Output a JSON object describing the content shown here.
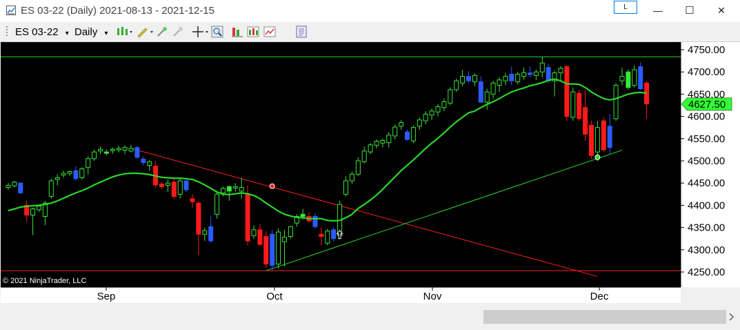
{
  "window": {
    "title": "ES 03-22 (Daily)  2021-08-13 - 2021-12-15",
    "link_button_label": "L",
    "minimize_glyph": "—",
    "maximize_glyph": "☐",
    "close_glyph": "✕"
  },
  "toolbar": {
    "instrument_label": "ES 03-22",
    "interval_label": "Daily",
    "dropdown_glyph": "▾",
    "icons": [
      "bar-style-icon",
      "drawing-tool-icon",
      "pencil-icon",
      "snap-icon",
      "crosshair-icon",
      "zoom-icon",
      "strategy-icon",
      "indicators-icon",
      "chart-properties-icon",
      "data-box-icon"
    ]
  },
  "colors": {
    "background": "#000000",
    "up_candle": "#39e639",
    "down_candle": "#ff1a1a",
    "blue_candle": "#2b5bff",
    "sma": "#2ad82a",
    "price_badge": "#33ff33"
  },
  "chart_data": {
    "type": "candlestick",
    "instrument": "ES 03-22",
    "interval": "Daily",
    "y_ticks": [
      "4750.00",
      "4700.00",
      "4650.00",
      "4600.00",
      "4550.00",
      "4500.00",
      "4450.00",
      "4400.00",
      "4350.00",
      "4300.00",
      "4250.00"
    ],
    "y_range": [
      4243,
      4760
    ],
    "x_labels": [
      "Sep",
      "Oct",
      "Nov",
      "Dec"
    ],
    "last_price": "4627.50",
    "copyright": "© 2021 NinjaTrader, LLC",
    "horizontal_lines": [
      {
        "price": 4734,
        "color": "#2ad82a"
      },
      {
        "price": 4253,
        "color": "#ff2020"
      }
    ],
    "trendlines": [
      {
        "color": "#ff2020",
        "from": {
          "bar": 20,
          "price": 4528
        },
        "to": {
          "bar": 96,
          "price": 4240
        },
        "anchor_dot": {
          "bar": 43,
          "price": 4443
        }
      },
      {
        "color": "#2ad82a",
        "from": {
          "bar": 42,
          "price": 4253
        },
        "to": {
          "bar": 100,
          "price": 4524
        },
        "anchor_dot": {
          "bar": 96,
          "price": 4508
        }
      }
    ],
    "candles": [
      {
        "o": 4440,
        "h": 4450,
        "l": 4435,
        "c": 4445,
        "t": "u"
      },
      {
        "o": 4444,
        "h": 4455,
        "l": 4440,
        "c": 4452,
        "t": "u"
      },
      {
        "o": 4450,
        "h": 4452,
        "l": 4425,
        "c": 4428,
        "t": "b"
      },
      {
        "o": 4400,
        "h": 4410,
        "l": 4362,
        "c": 4378,
        "t": "d"
      },
      {
        "o": 4378,
        "h": 4395,
        "l": 4333,
        "c": 4392,
        "t": "u"
      },
      {
        "o": 4390,
        "h": 4402,
        "l": 4385,
        "c": 4398,
        "t": "u"
      },
      {
        "o": 4375,
        "h": 4410,
        "l": 4355,
        "c": 4405,
        "t": "u"
      },
      {
        "o": 4420,
        "h": 4460,
        "l": 4415,
        "c": 4455,
        "t": "u"
      },
      {
        "o": 4458,
        "h": 4470,
        "l": 4445,
        "c": 4462,
        "t": "u"
      },
      {
        "o": 4468,
        "h": 4478,
        "l": 4462,
        "c": 4472,
        "t": "u"
      },
      {
        "o": 4472,
        "h": 4478,
        "l": 4466,
        "c": 4476,
        "t": "u"
      },
      {
        "o": 4478,
        "h": 4488,
        "l": 4455,
        "c": 4460,
        "t": "b"
      },
      {
        "o": 4462,
        "h": 4486,
        "l": 4458,
        "c": 4482,
        "t": "u"
      },
      {
        "o": 4485,
        "h": 4510,
        "l": 4470,
        "c": 4505,
        "t": "u"
      },
      {
        "o": 4505,
        "h": 4525,
        "l": 4500,
        "c": 4520,
        "t": "u"
      },
      {
        "o": 4522,
        "h": 4532,
        "l": 4515,
        "c": 4526,
        "t": "u"
      },
      {
        "o": 4520,
        "h": 4526,
        "l": 4513,
        "c": 4518,
        "t": "s"
      },
      {
        "o": 4523,
        "h": 4530,
        "l": 4516,
        "c": 4526,
        "t": "u"
      },
      {
        "o": 4525,
        "h": 4534,
        "l": 4519,
        "c": 4528,
        "t": "u"
      },
      {
        "o": 4524,
        "h": 4535,
        "l": 4515,
        "c": 4530,
        "t": "u"
      },
      {
        "o": 4528,
        "h": 4536,
        "l": 4519,
        "c": 4522,
        "t": "u"
      },
      {
        "o": 4530,
        "h": 4533,
        "l": 4505,
        "c": 4508,
        "t": "b"
      },
      {
        "o": 4504,
        "h": 4510,
        "l": 4490,
        "c": 4496,
        "t": "b"
      },
      {
        "o": 4498,
        "h": 4502,
        "l": 4478,
        "c": 4490,
        "t": "u"
      },
      {
        "o": 4488,
        "h": 4500,
        "l": 4440,
        "c": 4446,
        "t": "d"
      },
      {
        "o": 4448,
        "h": 4452,
        "l": 4437,
        "c": 4442,
        "t": "d"
      },
      {
        "o": 4445,
        "h": 4458,
        "l": 4430,
        "c": 4450,
        "t": "u"
      },
      {
        "o": 4452,
        "h": 4460,
        "l": 4415,
        "c": 4420,
        "t": "d"
      },
      {
        "o": 4425,
        "h": 4462,
        "l": 4415,
        "c": 4455,
        "t": "u"
      },
      {
        "o": 4455,
        "h": 4462,
        "l": 4430,
        "c": 4435,
        "t": "b"
      },
      {
        "o": 4415,
        "h": 4425,
        "l": 4395,
        "c": 4408,
        "t": "d"
      },
      {
        "o": 4405,
        "h": 4410,
        "l": 4288,
        "c": 4335,
        "t": "d"
      },
      {
        "o": 4335,
        "h": 4350,
        "l": 4320,
        "c": 4343,
        "t": "u"
      },
      {
        "o": 4352,
        "h": 4375,
        "l": 4315,
        "c": 4320,
        "t": "b"
      },
      {
        "o": 4380,
        "h": 4430,
        "l": 4370,
        "c": 4425,
        "t": "u"
      },
      {
        "o": 4428,
        "h": 4442,
        "l": 4420,
        "c": 4438,
        "t": "u"
      },
      {
        "o": 4432,
        "h": 4445,
        "l": 4410,
        "c": 4442,
        "t": "s"
      },
      {
        "o": 4440,
        "h": 4450,
        "l": 4430,
        "c": 4442,
        "t": "u"
      },
      {
        "o": 4440,
        "h": 4462,
        "l": 4415,
        "c": 4432,
        "t": "u"
      },
      {
        "o": 4425,
        "h": 4445,
        "l": 4310,
        "c": 4320,
        "t": "d"
      },
      {
        "o": 4332,
        "h": 4355,
        "l": 4325,
        "c": 4345,
        "t": "u"
      },
      {
        "o": 4345,
        "h": 4358,
        "l": 4310,
        "c": 4312,
        "t": "d"
      },
      {
        "o": 4330,
        "h": 4342,
        "l": 4260,
        "c": 4268,
        "t": "d"
      },
      {
        "o": 4265,
        "h": 4345,
        "l": 4253,
        "c": 4335,
        "t": "b"
      },
      {
        "o": 4268,
        "h": 4348,
        "l": 4258,
        "c": 4340,
        "t": "u"
      },
      {
        "o": 4318,
        "h": 4345,
        "l": 4263,
        "c": 4328,
        "t": "u"
      },
      {
        "o": 4330,
        "h": 4354,
        "l": 4325,
        "c": 4352,
        "t": "u"
      },
      {
        "o": 4360,
        "h": 4380,
        "l": 4352,
        "c": 4375,
        "t": "u"
      },
      {
        "o": 4375,
        "h": 4392,
        "l": 4368,
        "c": 4380,
        "t": "s"
      },
      {
        "o": 4375,
        "h": 4385,
        "l": 4360,
        "c": 4365,
        "t": "d"
      },
      {
        "o": 4375,
        "h": 4382,
        "l": 4348,
        "c": 4352,
        "t": "b"
      },
      {
        "o": 4335,
        "h": 4350,
        "l": 4310,
        "c": 4330,
        "t": "d"
      },
      {
        "o": 4315,
        "h": 4347,
        "l": 4310,
        "c": 4342,
        "t": "u"
      },
      {
        "o": 4325,
        "h": 4350,
        "l": 4318,
        "c": 4345,
        "t": "b"
      },
      {
        "o": 4332,
        "h": 4410,
        "l": 4326,
        "c": 4402,
        "t": "u"
      },
      {
        "o": 4425,
        "h": 4465,
        "l": 4420,
        "c": 4455,
        "t": "u"
      },
      {
        "o": 4455,
        "h": 4476,
        "l": 4448,
        "c": 4470,
        "t": "u"
      },
      {
        "o": 4470,
        "h": 4508,
        "l": 4466,
        "c": 4500,
        "t": "u"
      },
      {
        "o": 4498,
        "h": 4532,
        "l": 4494,
        "c": 4522,
        "t": "u"
      },
      {
        "o": 4520,
        "h": 4540,
        "l": 4515,
        "c": 4536,
        "t": "u"
      },
      {
        "o": 4535,
        "h": 4548,
        "l": 4528,
        "c": 4544,
        "t": "u"
      },
      {
        "o": 4540,
        "h": 4550,
        "l": 4530,
        "c": 4546,
        "t": "u"
      },
      {
        "o": 4541,
        "h": 4565,
        "l": 4530,
        "c": 4558,
        "t": "u"
      },
      {
        "o": 4556,
        "h": 4582,
        "l": 4548,
        "c": 4576,
        "t": "u"
      },
      {
        "o": 4578,
        "h": 4592,
        "l": 4570,
        "c": 4586,
        "t": "u"
      },
      {
        "o": 4565,
        "h": 4570,
        "l": 4545,
        "c": 4548,
        "t": "b"
      },
      {
        "o": 4545,
        "h": 4580,
        "l": 4540,
        "c": 4575,
        "t": "u"
      },
      {
        "o": 4578,
        "h": 4598,
        "l": 4570,
        "c": 4592,
        "t": "u"
      },
      {
        "o": 4590,
        "h": 4612,
        "l": 4582,
        "c": 4605,
        "t": "u"
      },
      {
        "o": 4603,
        "h": 4618,
        "l": 4592,
        "c": 4612,
        "t": "u"
      },
      {
        "o": 4610,
        "h": 4628,
        "l": 4600,
        "c": 4622,
        "t": "u"
      },
      {
        "o": 4620,
        "h": 4640,
        "l": 4612,
        "c": 4633,
        "t": "u"
      },
      {
        "o": 4630,
        "h": 4665,
        "l": 4625,
        "c": 4660,
        "t": "u"
      },
      {
        "o": 4660,
        "h": 4685,
        "l": 4655,
        "c": 4680,
        "t": "u"
      },
      {
        "o": 4675,
        "h": 4705,
        "l": 4668,
        "c": 4690,
        "t": "u"
      },
      {
        "o": 4690,
        "h": 4702,
        "l": 4675,
        "c": 4680,
        "t": "b"
      },
      {
        "o": 4678,
        "h": 4697,
        "l": 4668,
        "c": 4692,
        "t": "u"
      },
      {
        "o": 4678,
        "h": 4690,
        "l": 4630,
        "c": 4632,
        "t": "b"
      },
      {
        "o": 4632,
        "h": 4662,
        "l": 4615,
        "c": 4655,
        "t": "u"
      },
      {
        "o": 4650,
        "h": 4680,
        "l": 4640,
        "c": 4675,
        "t": "u"
      },
      {
        "o": 4670,
        "h": 4688,
        "l": 4655,
        "c": 4682,
        "t": "u"
      },
      {
        "o": 4680,
        "h": 4698,
        "l": 4670,
        "c": 4690,
        "t": "u"
      },
      {
        "o": 4695,
        "h": 4712,
        "l": 4670,
        "c": 4680,
        "t": "b"
      },
      {
        "o": 4678,
        "h": 4700,
        "l": 4672,
        "c": 4695,
        "t": "u"
      },
      {
        "o": 4690,
        "h": 4710,
        "l": 4682,
        "c": 4698,
        "t": "u"
      },
      {
        "o": 4698,
        "h": 4712,
        "l": 4688,
        "c": 4694,
        "t": "b"
      },
      {
        "o": 4692,
        "h": 4705,
        "l": 4682,
        "c": 4700,
        "t": "u"
      },
      {
        "o": 4700,
        "h": 4734,
        "l": 4688,
        "c": 4720,
        "t": "u"
      },
      {
        "o": 4710,
        "h": 4718,
        "l": 4675,
        "c": 4680,
        "t": "b"
      },
      {
        "o": 4680,
        "h": 4703,
        "l": 4645,
        "c": 4698,
        "t": "u"
      },
      {
        "o": 4698,
        "h": 4713,
        "l": 4680,
        "c": 4708,
        "t": "u"
      },
      {
        "o": 4712,
        "h": 4715,
        "l": 4590,
        "c": 4600,
        "t": "d"
      },
      {
        "o": 4598,
        "h": 4665,
        "l": 4590,
        "c": 4655,
        "t": "u"
      },
      {
        "o": 4652,
        "h": 4660,
        "l": 4590,
        "c": 4595,
        "t": "d"
      },
      {
        "o": 4620,
        "h": 4660,
        "l": 4545,
        "c": 4560,
        "t": "d"
      },
      {
        "o": 4580,
        "h": 4590,
        "l": 4505,
        "c": 4512,
        "t": "d"
      },
      {
        "o": 4520,
        "h": 4590,
        "l": 4500,
        "c": 4575,
        "t": "u"
      },
      {
        "o": 4590,
        "h": 4598,
        "l": 4520,
        "c": 4525,
        "t": "d"
      },
      {
        "o": 4530,
        "h": 4605,
        "l": 4515,
        "c": 4578,
        "t": "b"
      },
      {
        "o": 4595,
        "h": 4675,
        "l": 4590,
        "c": 4670,
        "t": "u"
      },
      {
        "o": 4680,
        "h": 4710,
        "l": 4670,
        "c": 4690,
        "t": "u"
      },
      {
        "o": 4700,
        "h": 4706,
        "l": 4660,
        "c": 4665,
        "t": "s"
      },
      {
        "o": 4670,
        "h": 4715,
        "l": 4665,
        "c": 4705,
        "t": "u"
      },
      {
        "o": 4712,
        "h": 4722,
        "l": 4660,
        "c": 4662,
        "t": "b"
      },
      {
        "o": 4675,
        "h": 4680,
        "l": 4595,
        "c": 4628,
        "t": "d"
      }
    ],
    "sma": [
      4388,
      4392,
      4396,
      4398,
      4399,
      4400,
      4402,
      4405,
      4410,
      4416,
      4422,
      4428,
      4433,
      4439,
      4446,
      4452,
      4458,
      4464,
      4468,
      4471,
      4472,
      4472,
      4471,
      4469,
      4466,
      4463,
      4462,
      4461,
      4461,
      4460,
      4458,
      4453,
      4446,
      4438,
      4430,
      4425,
      4424,
      4426,
      4428,
      4426,
      4422,
      4415,
      4405,
      4396,
      4387,
      4380,
      4376,
      4373,
      4372,
      4370,
      4370,
      4370,
      4366,
      4365,
      4366,
      4372,
      4380,
      4393,
      4402,
      4412,
      4423,
      4436,
      4450,
      4464,
      4478,
      4490,
      4502,
      4515,
      4528,
      4540,
      4551,
      4563,
      4576,
      4588,
      4598,
      4608,
      4612,
      4620,
      4627,
      4633,
      4640,
      4648,
      4655,
      4660,
      4664,
      4669,
      4672,
      4676,
      4681,
      4684,
      4680,
      4673,
      4673,
      4672,
      4665,
      4655,
      4647,
      4640,
      4637,
      4640,
      4645,
      4650,
      4653,
      4654,
      4652
    ]
  }
}
